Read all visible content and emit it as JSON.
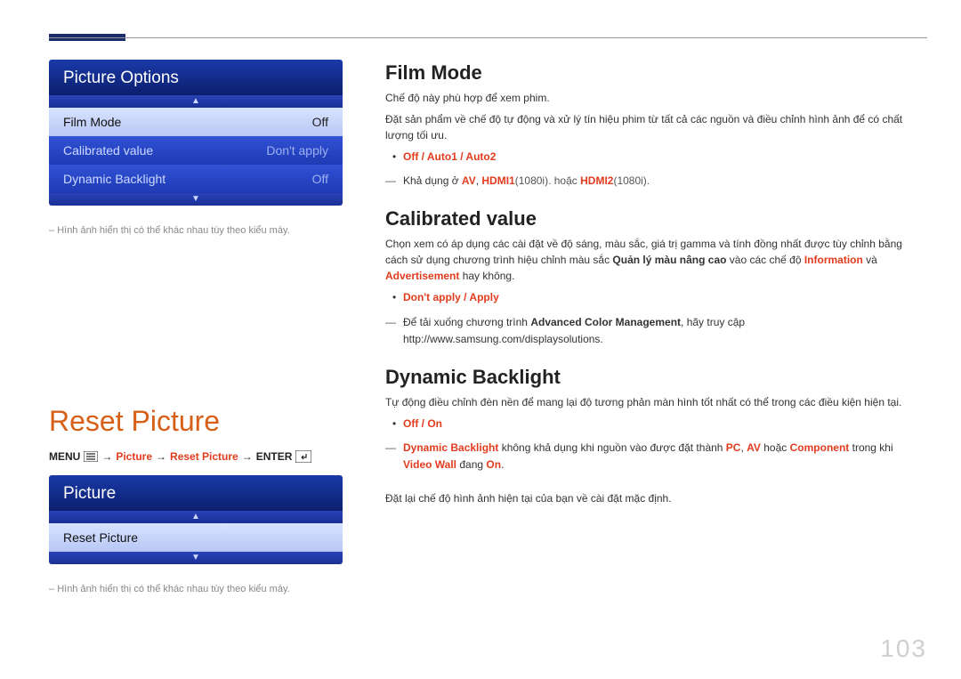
{
  "page_number": "103",
  "left": {
    "panel1": {
      "title": "Picture Options",
      "rows": [
        {
          "label": "Film Mode",
          "value": "Off",
          "selected": true
        },
        {
          "label": "Calibrated value",
          "value": "Don't apply",
          "selected": false
        },
        {
          "label": "Dynamic Backlight",
          "value": "Off",
          "selected": false
        }
      ]
    },
    "footnote1": "Hình ảnh hiển thị có thể khác nhau tùy theo kiểu máy.",
    "reset_heading": "Reset Picture",
    "navpath": {
      "menu_word": "MENU",
      "seg1": "Picture",
      "seg2": "Reset Picture",
      "enter_word": "ENTER"
    },
    "panel2": {
      "title": "Picture",
      "rows": [
        {
          "label": "Reset Picture",
          "value": "",
          "selected": true
        }
      ]
    },
    "footnote2": "Hình ảnh hiển thị có thể khác nhau tùy theo kiểu máy."
  },
  "right": {
    "film": {
      "heading": "Film Mode",
      "p1": "Chế độ này phù hợp để xem phim.",
      "p2": "Đặt sản phẩm về chế độ tự động và xử lý tín hiệu phim từ tất cả các nguồn và điều chỉnh hình ảnh để có chất lượng tối ưu.",
      "options": "Off / Auto1 / Auto2",
      "note_pre": "Khả dụng ở ",
      "note_av": "AV",
      "note_mid1": ", ",
      "note_hdmi1": "HDMI1",
      "note_1080a": "(1080i). hoặc ",
      "note_hdmi2": "HDMI2",
      "note_1080b": "(1080i)."
    },
    "cal": {
      "heading": "Calibrated value",
      "p_pre": "Chọn xem có áp dụng các cài đặt về độ sáng, màu sắc, giá trị gamma và tính đồng nhất được tùy chỉnh bằng cách sử dụng chương trình hiệu chỉnh màu sắc ",
      "p_bold1": "Quản lý màu nâng cao",
      "p_mid1": " vào các chế độ ",
      "p_red1": "Information",
      "p_mid2": " và ",
      "p_red2": "Advertisement",
      "p_after": " hay không.",
      "options": "Don't apply / Apply",
      "dl_pre": "Để tải xuống chương trình ",
      "dl_bold": "Advanced Color Management",
      "dl_after": ", hãy truy cập http://www.samsung.com/displaysolutions."
    },
    "dyn": {
      "heading": "Dynamic Backlight",
      "p1": "Tự động điều chỉnh đèn nền để mang lại độ tương phản màn hình tốt nhất có thể trong các điều kiện hiện tại.",
      "options": "Off / On",
      "note_feat": "Dynamic Backlight",
      "note_mid1": " không khả dụng khi nguồn vào được đặt thành ",
      "note_pc": "PC",
      "note_mid2": ", ",
      "note_av": "AV",
      "note_mid3": " hoặc ",
      "note_comp": "Component",
      "note_mid4": " trong khi ",
      "note_vw": "Video Wall",
      "note_mid5": " đang ",
      "note_on": "On",
      "note_end": "."
    },
    "reset_text": "Đặt lại chế độ hình ảnh hiện tại của bạn về cài đặt mặc định."
  }
}
